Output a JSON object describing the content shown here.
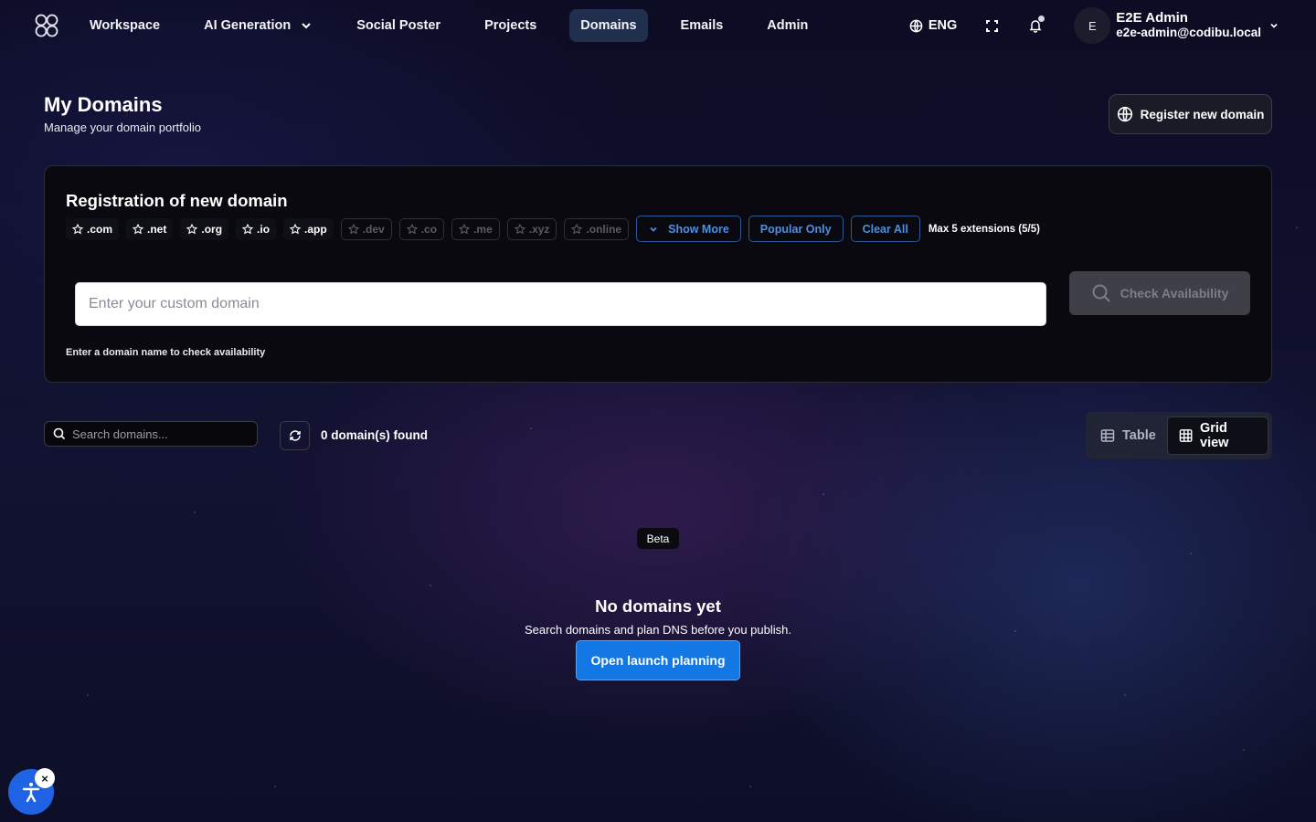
{
  "nav": {
    "logo": "infinity-logo-icon",
    "items": [
      {
        "label": "Workspace"
      },
      {
        "label": "AI Generation",
        "has_dropdown": true
      },
      {
        "label": "Social Poster"
      },
      {
        "label": "Projects"
      },
      {
        "label": "Domains",
        "active": true
      },
      {
        "label": "Emails"
      },
      {
        "label": "Admin"
      }
    ],
    "language": "ENG",
    "fullscreen_icon": "expand-icon",
    "notification_icon": "bell-icon",
    "user": {
      "initial": "E",
      "name": "E2E Admin",
      "email": "e2e-admin@codibu.local"
    }
  },
  "header": {
    "title": "My Domains",
    "subtitle": "Manage your domain portfolio",
    "register_label": "Register new domain"
  },
  "registration": {
    "title": "Registration of new domain",
    "extensions": [
      {
        "label": ".com",
        "selected": true
      },
      {
        "label": ".net",
        "selected": true
      },
      {
        "label": ".org",
        "selected": true
      },
      {
        "label": ".io",
        "selected": true
      },
      {
        "label": ".app",
        "selected": true
      },
      {
        "label": ".dev",
        "selected": false
      },
      {
        "label": ".co",
        "selected": false
      },
      {
        "label": ".me",
        "selected": false
      },
      {
        "label": ".xyz",
        "selected": false
      },
      {
        "label": ".online",
        "selected": false
      }
    ],
    "show_more": "Show More",
    "popular_only": "Popular Only",
    "clear_all": "Clear All",
    "max_info": "Max 5 extensions (5/5)",
    "input_placeholder": "Enter your custom domain",
    "input_value": "",
    "check_label": "Check Availability",
    "hint": "Enter a domain name to check availability"
  },
  "toolbar": {
    "search_placeholder": "Search domains...",
    "found_text": "0 domain(s) found",
    "view_options": [
      {
        "label": "Table",
        "active": false
      },
      {
        "label": "Grid view",
        "active": true
      }
    ]
  },
  "empty_state": {
    "badge": "Beta",
    "title": "No domains yet",
    "subtitle": "Search domains and plan DNS before you publish.",
    "button_label": "Open launch planning"
  },
  "colors": {
    "accent": "#1378e4",
    "outline_blue": "#4e8fe0",
    "active_nav": "#1f2f4d"
  }
}
